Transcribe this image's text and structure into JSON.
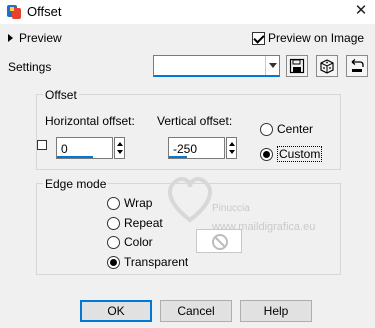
{
  "window": {
    "title": "Offset"
  },
  "preview": {
    "label": "Preview",
    "on_image_label": "Preview on Image",
    "on_image_checked": true
  },
  "settings": {
    "label": "Settings",
    "value": ""
  },
  "offset": {
    "group_title": "Offset",
    "horizontal_label": "Horizontal offset:",
    "horizontal_value": "0",
    "vertical_label": "Vertical offset:",
    "vertical_value": "-250",
    "radio_center": "Center",
    "radio_custom": "Custom",
    "selected": "Custom"
  },
  "edge_mode": {
    "group_title": "Edge mode",
    "options": [
      "Wrap",
      "Repeat",
      "Color",
      "Transparent"
    ],
    "selected": "Transparent"
  },
  "watermark": {
    "name": "Pinuccia",
    "url": "www.maildigrafica.eu"
  },
  "buttons": {
    "ok": "OK",
    "cancel": "Cancel",
    "help": "Help"
  },
  "colors": {
    "accent": "#0078d7",
    "dialog_bg": "#f0f0f0"
  }
}
